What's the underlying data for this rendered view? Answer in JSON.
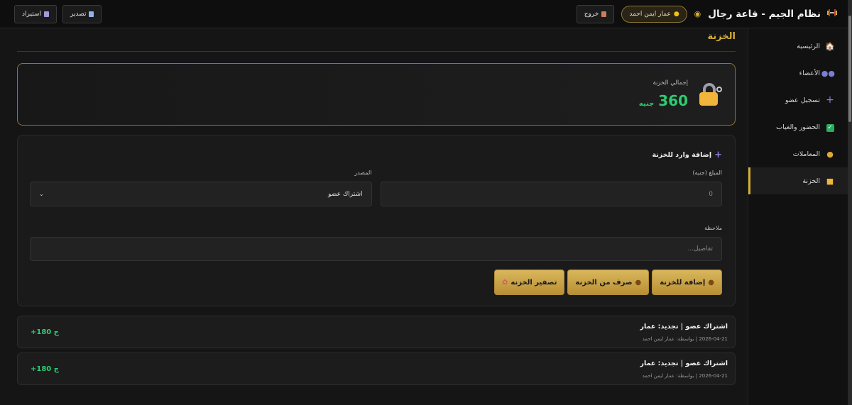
{
  "header": {
    "title": "نظام الجيم - قاعة رجال",
    "user_name": "عمار ايمن احمد",
    "logout_label": "خروج",
    "export_label": "تصدير",
    "import_label": "استيراد"
  },
  "sidebar": {
    "items": [
      {
        "label": "الرئيسية",
        "icon": "home-icon"
      },
      {
        "label": "الأعضاء",
        "icon": "members-icon"
      },
      {
        "label": "تسجيل عضو",
        "icon": "plus-icon"
      },
      {
        "label": "الحضور والغياب",
        "icon": "check-icon"
      },
      {
        "label": "المعاملات",
        "icon": "money-bag-icon"
      },
      {
        "label": "الخزنة",
        "icon": "lock-icon",
        "active": true
      }
    ]
  },
  "page": {
    "title": "الخزنة"
  },
  "treasury": {
    "label": "إجمالي الخزنة",
    "amount": "360",
    "unit": "جنيه"
  },
  "form": {
    "title": "إضافة وارد للخزنة",
    "amount_label": "المبلغ (جنيه)",
    "amount_placeholder": "0",
    "source_label": "المصدر",
    "source_value": "اشتراك عضو",
    "note_label": "ملاحظة",
    "note_placeholder": "تفاصيل...",
    "btn_add": "إضافة للخزنة",
    "btn_withdraw": "صرف من الخزنة",
    "btn_reset": "تصفير الخزنه"
  },
  "transactions": [
    {
      "title": "اشتراك عضو | تجديد: عمار",
      "meta": "2026-04-21 | بواسطة: عمار ايمن احمد",
      "amount": "+180 ج"
    },
    {
      "title": "اشتراك عضو | تجديد: عمار",
      "meta": "2026-04-21 | بواسطة: عمار ايمن احمد",
      "amount": "+180 ج"
    }
  ],
  "colors": {
    "accent": "#d4af37",
    "positive": "#2ecc71"
  }
}
